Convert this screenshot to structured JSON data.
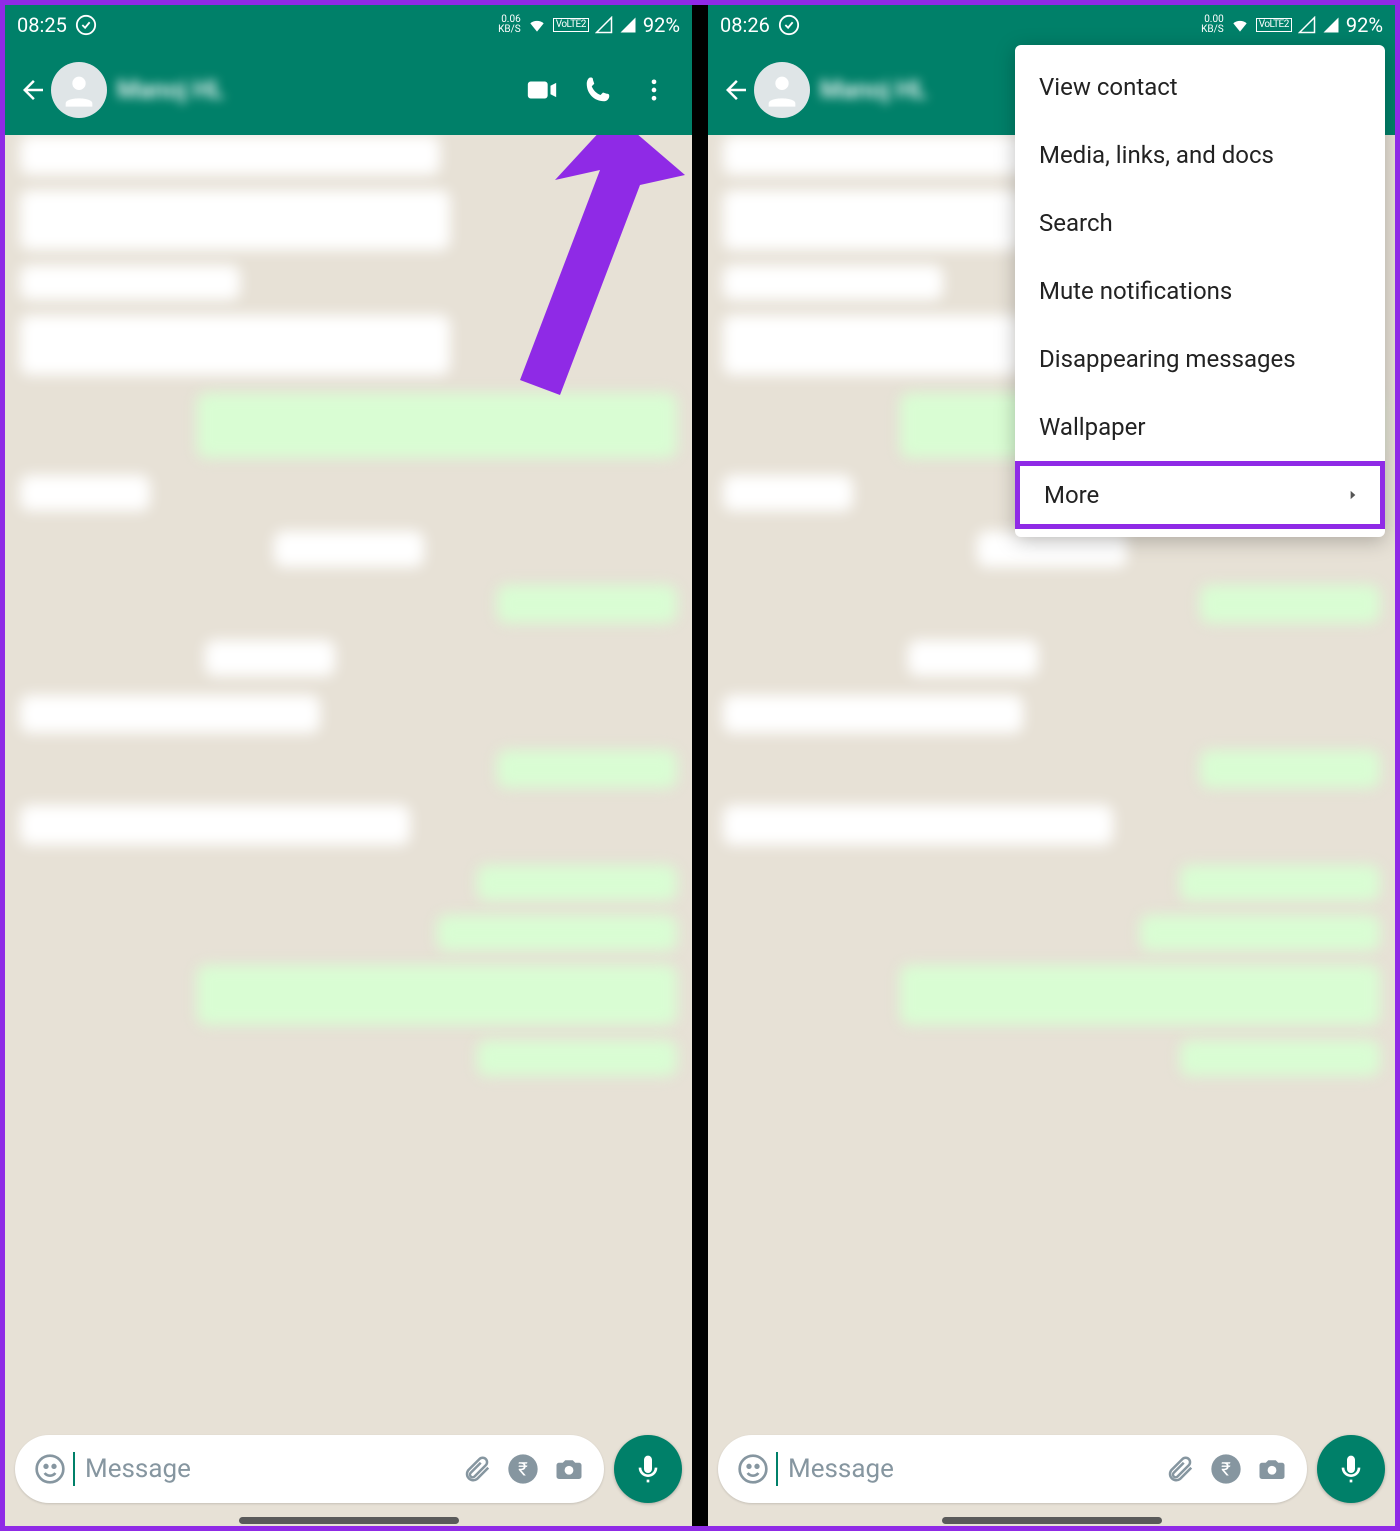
{
  "colors": {
    "primary": "#008069",
    "annotation": "#8f2ae6"
  },
  "left": {
    "status": {
      "time": "08:25",
      "kbs": "0.06",
      "kbs_unit": "KB/S",
      "lte": "VoLTE2",
      "battery": "92%"
    },
    "contact": "Manoj HL",
    "input_placeholder": "Message"
  },
  "right": {
    "status": {
      "time": "08:26",
      "kbs": "0.00",
      "kbs_unit": "KB/S",
      "lte": "VoLTE2",
      "battery": "92%"
    },
    "contact": "Manoj HL",
    "input_placeholder": "Message",
    "menu": [
      {
        "label": "View contact",
        "submenu": false
      },
      {
        "label": "Media, links, and docs",
        "submenu": false
      },
      {
        "label": "Search",
        "submenu": false
      },
      {
        "label": "Mute notifications",
        "submenu": false
      },
      {
        "label": "Disappearing messages",
        "submenu": false
      },
      {
        "label": "Wallpaper",
        "submenu": false
      },
      {
        "label": "More",
        "submenu": true,
        "highlighted": true
      }
    ]
  }
}
